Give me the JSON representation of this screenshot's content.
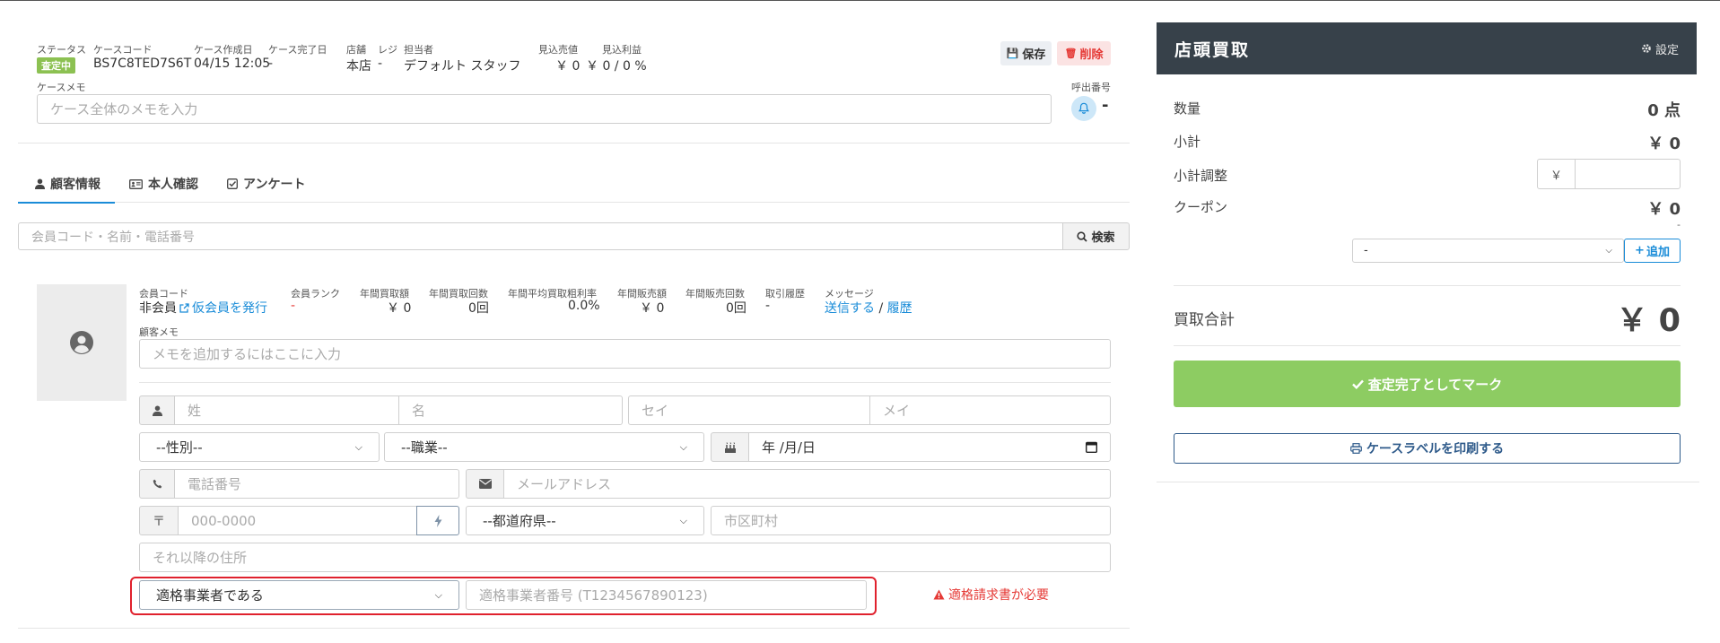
{
  "case_header": {
    "status_label": "ステータス",
    "status_badge": "査定中",
    "case_code_label": "ケースコード",
    "case_code": "BS7C8TED7S6T",
    "created_label": "ケース作成日",
    "created_value": "04/15 12:05",
    "completed_label": "ケース完了日",
    "completed_value": "-",
    "store_label": "店舗",
    "store_value": "本店",
    "register_label": "レジ",
    "register_value": "-",
    "staff_label": "担当者",
    "staff_value": "デフォルト スタッフ",
    "sales_label": "見込売値",
    "sales_value": "￥ 0",
    "profit_label": "見込利益",
    "profit_value": "￥ 0 / 0 %",
    "save_label": "保存",
    "delete_label": "削除",
    "memo_label": "ケースメモ",
    "memo_placeholder": "ケース全体のメモを入力",
    "call_number_label": "呼出番号",
    "call_number_value": "-"
  },
  "tabs": [
    {
      "label": "顧客情報",
      "active": true
    },
    {
      "label": "本人確認",
      "active": false
    },
    {
      "label": "アンケート",
      "active": false
    }
  ],
  "search": {
    "placeholder": "会員コード・名前・電話番号",
    "button_label": "検索"
  },
  "customer": {
    "member_code_label": "会員コード",
    "member_code_value": "非会員",
    "issue_temp_member": "仮会員を発行",
    "rank_label": "会員ランク",
    "rank_value": "-",
    "annual_buy_amount_label": "年間買取額",
    "annual_buy_amount_value": "￥ 0",
    "annual_buy_count_label": "年間買取回数",
    "annual_buy_count_value": "0回",
    "avg_margin_label": "年間平均買取粗利率",
    "avg_margin_value": "0.0%",
    "annual_sales_amount_label": "年間販売額",
    "annual_sales_amount_value": "￥ 0",
    "annual_sales_count_label": "年間販売回数",
    "annual_sales_count_value": "0回",
    "history_label": "取引履歴",
    "history_value": "-",
    "message_label": "メッセージ",
    "message_send": "送信する",
    "message_sep": "/",
    "message_history": "履歴",
    "memo_label": "顧客メモ",
    "memo_placeholder": "メモを追加するにはここに入力"
  },
  "form": {
    "last_name": "姓",
    "first_name": "名",
    "last_name_kana": "セイ",
    "first_name_kana": "メイ",
    "gender": "--性別--",
    "occupation": "--職業--",
    "birthday": "年 /月/日",
    "phone": "電話番号",
    "email": "メールアドレス",
    "zip_symbol": "〒",
    "zip": "000-0000",
    "prefecture": "--都道府県--",
    "city": "市区町村",
    "address": "それ以降の住所",
    "invoice_status": "適格事業者である",
    "invoice_number": "適格事業者番号 (T1234567890123)",
    "invoice_warning": "適格請求書が必要"
  },
  "panel": {
    "title": "店頭買取",
    "settings_label": "設定",
    "quantity_label": "数量",
    "quantity_value": "0 点",
    "subtotal_label": "小計",
    "subtotal_value": "￥ 0",
    "adjust_label": "小計調整",
    "currency_symbol": "￥",
    "coupon_label": "クーポン",
    "coupon_value": "￥ 0",
    "coupon_sub": "-",
    "coupon_select": "-",
    "add_label": "追加",
    "total_label": "買取合計",
    "total_value": "￥ 0",
    "complete_label": "査定完了としてマーク",
    "print_label": "ケースラベルを印刷する"
  },
  "colors": {
    "badge_green": "#8cc152",
    "header_dark": "#37414a",
    "complete_green": "#8dcc62",
    "link_blue": "#1a8cd8",
    "danger_red": "#e53935",
    "highlight_red": "#e0212d"
  }
}
